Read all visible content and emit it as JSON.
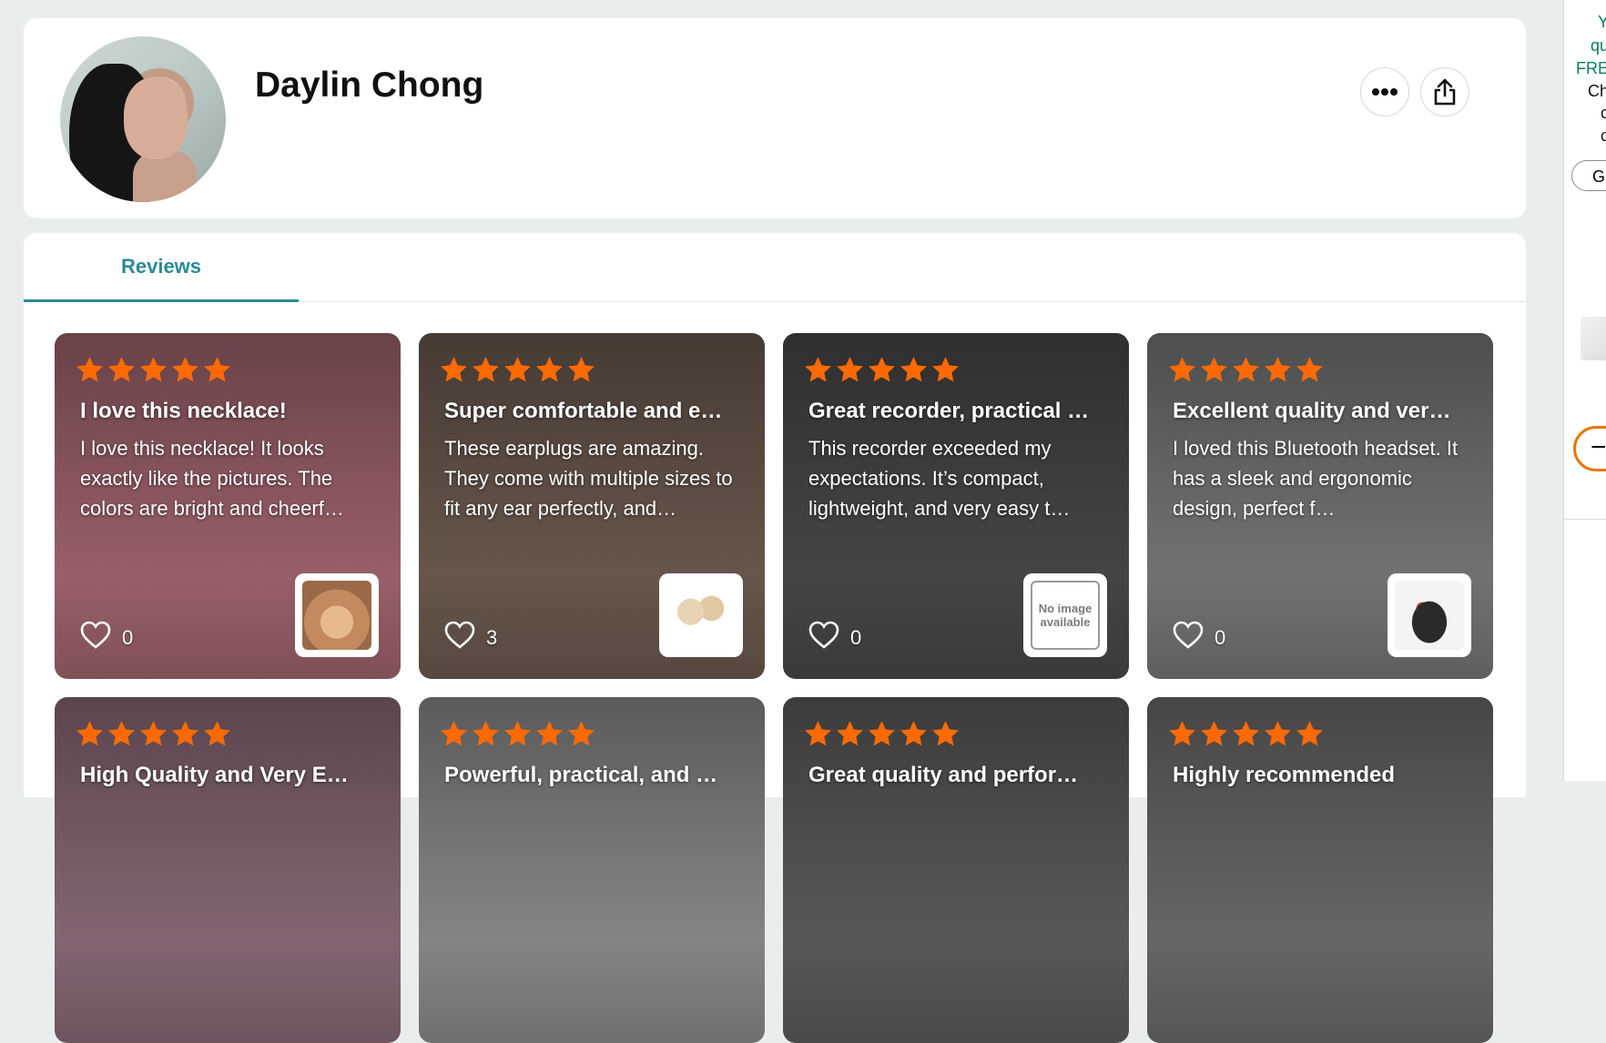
{
  "profile": {
    "name": "Daylin Chong",
    "avatar_icon": "avatar-photo"
  },
  "tabs": [
    {
      "label": "Reviews",
      "active": true
    }
  ],
  "reviews": [
    {
      "rating": 5,
      "title": "I love this necklace!",
      "body": "I love this necklace! It looks exactly like the pictures. The colors are bright and cheerf…",
      "likes": "0",
      "bg": "#a0646d"
    },
    {
      "rating": 5,
      "title": "Super comfortable and e…",
      "body": "These earplugs are amazing. They come with multiple sizes to fit any ear perfectly, and…",
      "likes": "3",
      "bg": "#6b5a4f"
    },
    {
      "rating": 5,
      "title": "Great recorder, practical …",
      "body": "This recorder exceeded my expectations. It’s compact, lightweight, and very easy t…",
      "likes": "0",
      "bg": "#4a4747",
      "thumb_text": "No image available"
    },
    {
      "rating": 5,
      "title": "Excellent quality and ver…",
      "body": "I loved this Bluetooth headset. It has a sleek and ergonomic design, perfect f…",
      "likes": "0",
      "bg": "#777777"
    },
    {
      "rating": 5,
      "title": "High Quality and Very E…",
      "bg": "#8a6a78"
    },
    {
      "rating": 5,
      "title": "Powerful, practical, and …",
      "bg": "#8b8b8b"
    },
    {
      "rating": 5,
      "title": "Great quality and perfor…",
      "bg": "#5c5c5c"
    },
    {
      "rating": 5,
      "title": "Highly recommended",
      "bg": "#6d6a6a"
    }
  ],
  "right_rail": {
    "lines": [
      "Y",
      "qu",
      "FRE",
      "Ch",
      "c",
      "c"
    ],
    "button_label": "G",
    "stepper_symbol": "−"
  },
  "colors": {
    "star": "#ff6a00",
    "tab_accent": "#2b8a96",
    "background": "#eaeded"
  }
}
